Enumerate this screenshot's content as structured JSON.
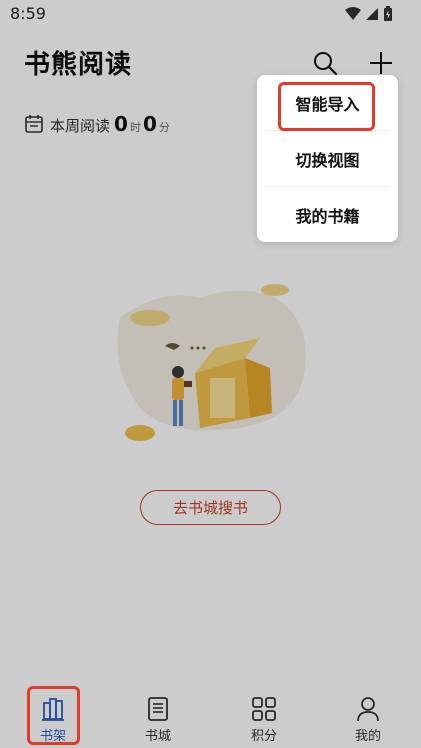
{
  "status_bar": {
    "time": "8:59"
  },
  "header": {
    "title": "书熊阅读"
  },
  "weekly_reading": {
    "label": "本周阅读",
    "hours": "0",
    "hours_unit": "时",
    "minutes": "0",
    "minutes_unit": "分"
  },
  "empty_state": {
    "go_store_label": "去书城搜书"
  },
  "popup_menu": {
    "items": [
      {
        "label": "智能导入",
        "highlighted": true
      },
      {
        "label": "切换视图"
      },
      {
        "label": "我的书籍"
      }
    ]
  },
  "bottom_nav": {
    "items": [
      {
        "label": "书架",
        "icon": "bookshelf-icon",
        "active": true
      },
      {
        "label": "书城",
        "icon": "book-icon"
      },
      {
        "label": "积分",
        "icon": "grid-icon"
      },
      {
        "label": "我的",
        "icon": "person-icon"
      }
    ]
  },
  "colors": {
    "accent": "#c9432d",
    "active_nav": "#2b63c6",
    "highlight": "#e23a2b"
  }
}
